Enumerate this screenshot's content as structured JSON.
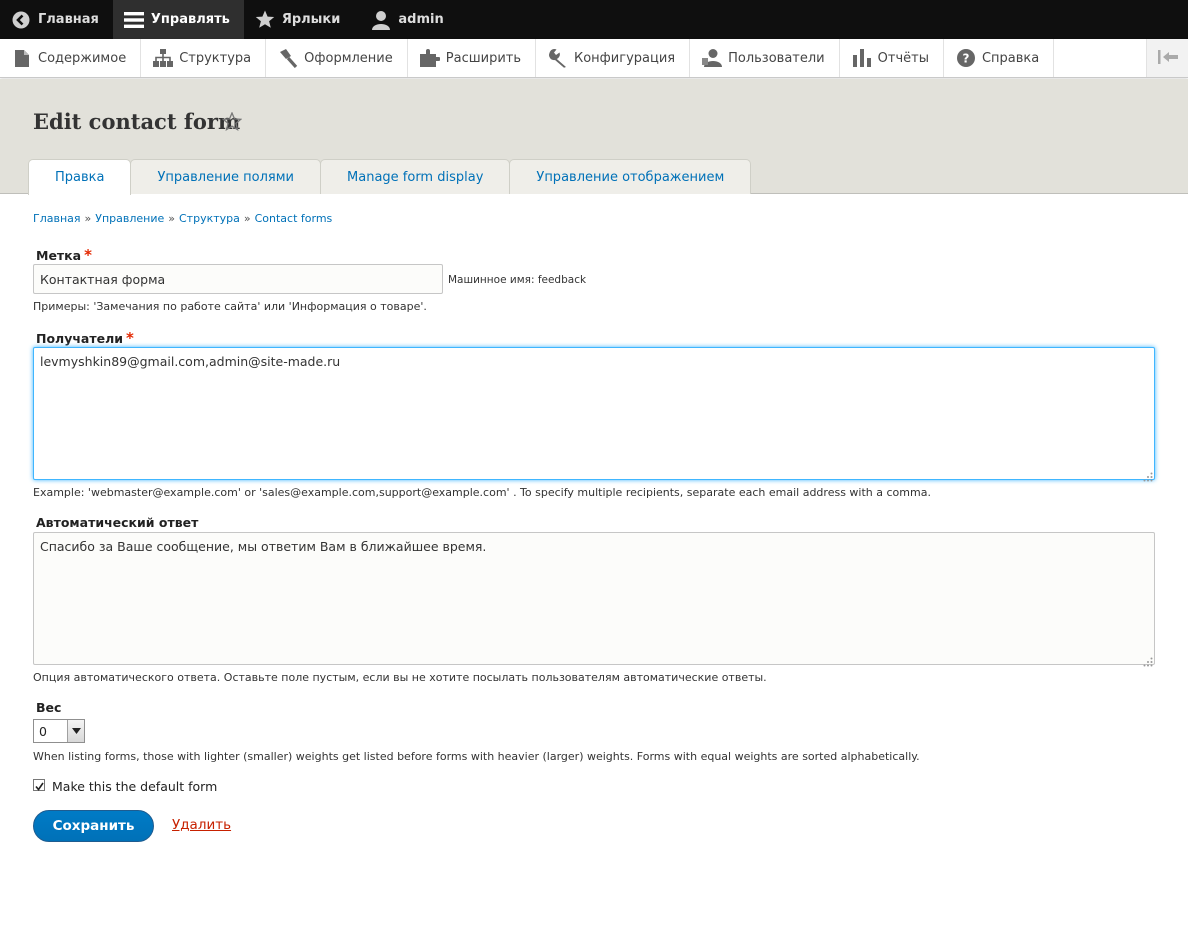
{
  "toolbar": {
    "items": [
      {
        "label": "Главная",
        "icon": "back-arrow-icon"
      },
      {
        "label": "Управлять",
        "icon": "menu-icon"
      },
      {
        "label": "Ярлыки",
        "icon": "star-icon"
      },
      {
        "label": "admin",
        "icon": "user-icon"
      }
    ]
  },
  "tray": {
    "items": [
      {
        "label": "Содержимое",
        "icon": "file-icon"
      },
      {
        "label": "Структура",
        "icon": "sitemap-icon"
      },
      {
        "label": "Оформление",
        "icon": "brush-icon"
      },
      {
        "label": "Расширить",
        "icon": "puzzle-icon"
      },
      {
        "label": "Конфигурация",
        "icon": "wrench-icon"
      },
      {
        "label": "Пользователи",
        "icon": "users-icon"
      },
      {
        "label": "Отчёты",
        "icon": "bar-chart-icon"
      },
      {
        "label": "Справка",
        "icon": "help-icon"
      }
    ]
  },
  "page": {
    "title": "Edit contact form"
  },
  "tabs": [
    {
      "label": "Правка",
      "active": true
    },
    {
      "label": "Управление полями",
      "active": false
    },
    {
      "label": "Manage form display",
      "active": false
    },
    {
      "label": "Управление отображением",
      "active": false
    }
  ],
  "breadcrumb": {
    "items": [
      "Главная",
      "Управление",
      "Структура",
      "Contact forms"
    ],
    "separator": "»"
  },
  "form": {
    "label": {
      "title": "Метка",
      "required_mark": "*",
      "value": "Контактная форма",
      "machine_name": "Машинное имя: feedback",
      "description": "Примеры: 'Замечания по работе сайта' или 'Информация о товаре'."
    },
    "recipients": {
      "title": "Получатели",
      "required_mark": "*",
      "value": "levmyshkin89@gmail.com,admin@site-made.ru",
      "description": "Example: 'webmaster@example.com' or 'sales@example.com,support@example.com' . To specify multiple recipients, separate each email address with a comma."
    },
    "reply": {
      "title": "Автоматический ответ",
      "value": "Спасибо за Ваше сообщение, мы ответим Вам в ближайшее время.",
      "description": "Опция автоматического ответа. Оставьте поле пустым, если вы не хотите посылать пользователям автоматические ответы."
    },
    "weight": {
      "title": "Вес",
      "value": "0",
      "description": "When listing forms, those with lighter (smaller) weights get listed before forms with heavier (larger) weights. Forms with equal weights are sorted alphabetically."
    },
    "default_form": {
      "label": "Make this the default form",
      "checked": true
    },
    "save_label": "Сохранить",
    "delete_label": "Удалить"
  },
  "colors": {
    "link": "#0071b8",
    "required": "#e32700",
    "primary_button": "#0071b8",
    "delete": "#c72100",
    "header_bg": "#e2e1da",
    "toolbar_bg": "#0f0f0f"
  }
}
